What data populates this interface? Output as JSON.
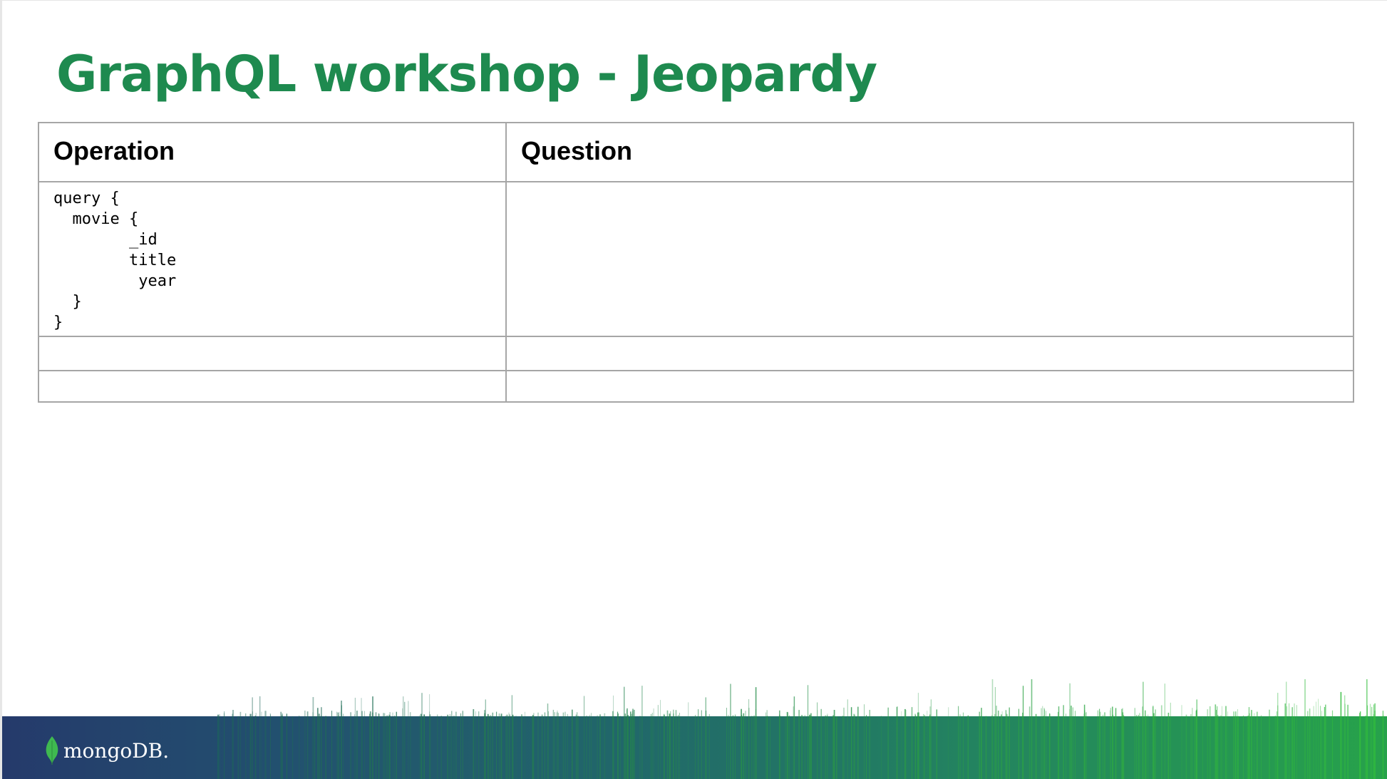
{
  "slide": {
    "title": "GraphQL workshop - Jeopardy"
  },
  "table": {
    "headers": {
      "operation": "Operation",
      "question": "Question"
    },
    "rows": [
      {
        "operation": "query {\n  movie {\n        _id\n        title\n         year\n  }\n}",
        "question": ""
      },
      {
        "operation": "",
        "question": ""
      },
      {
        "operation": "",
        "question": ""
      }
    ]
  },
  "footer": {
    "logo_text": "mongoDB.",
    "colors": {
      "left": "#253a6b",
      "right": "#27a24b",
      "leaf": "#3fb950"
    }
  },
  "colors": {
    "title": "#1e8a4f",
    "table_border": "#a6a6a6"
  }
}
